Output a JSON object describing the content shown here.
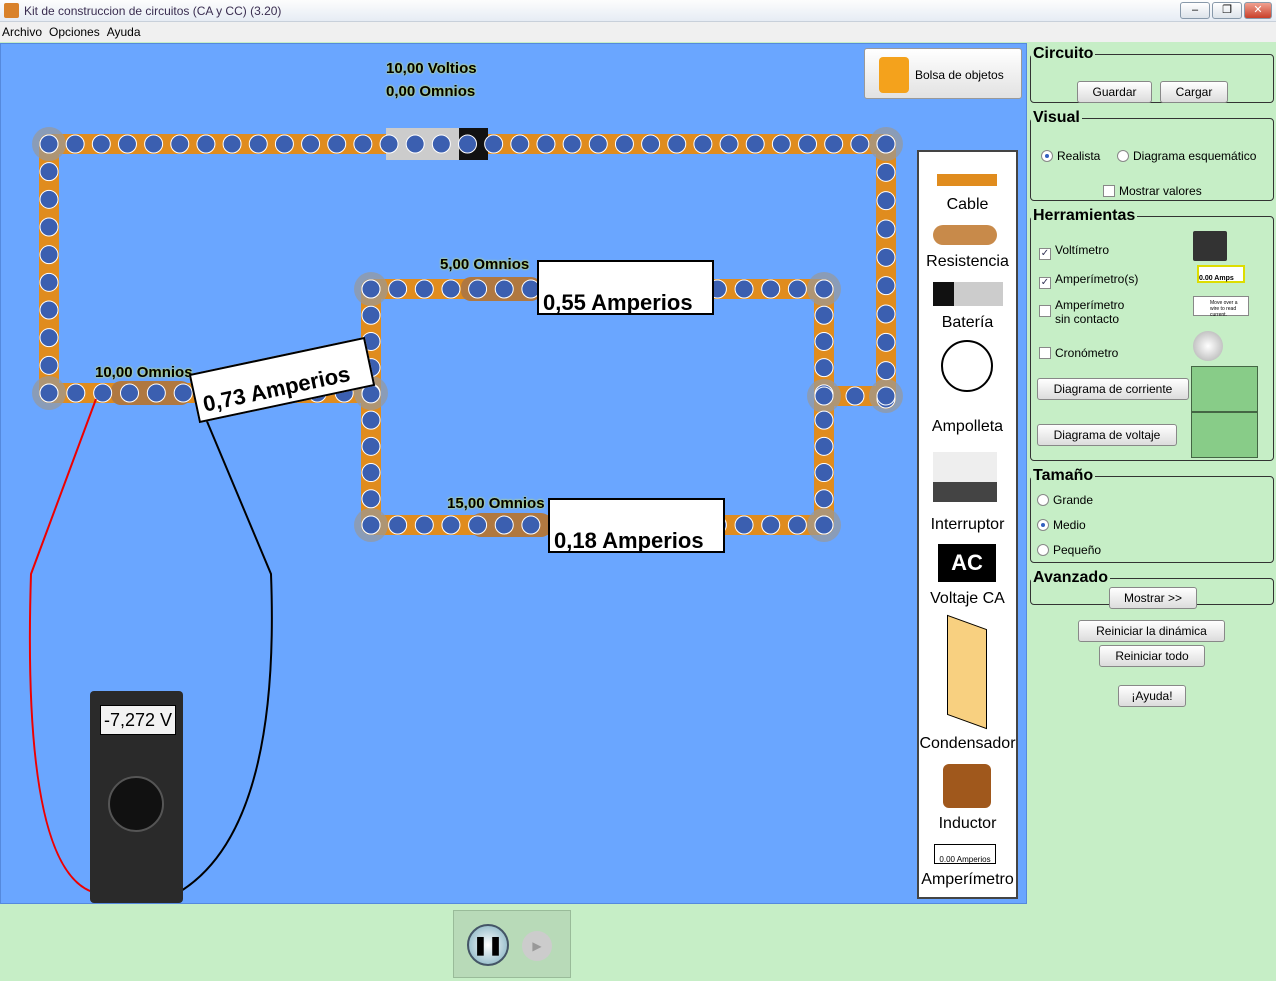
{
  "window": {
    "title": "Kit de construccion de circuitos (CA y CC) (3.20)"
  },
  "menu": [
    "Archivo",
    "Opciones",
    "Ayuda"
  ],
  "canvas": {
    "bag_label": "Bolsa de objetos",
    "battery": {
      "voltage": "10,00 Voltios",
      "resistance": "0,00 Omnios"
    },
    "resistors": [
      "10,00 Omnios",
      "5,00 Omnios",
      "15,00 Omnios"
    ],
    "ammeters": [
      "0,73 Amperios",
      "0,55 Amperios",
      "0,18 Amperios"
    ],
    "voltmeter_reading": "-7,272 V",
    "colors": {
      "background": "#6aa6ff",
      "wire": "#e08c1e",
      "electron": "#3b5fb0"
    }
  },
  "toolbox": [
    "Cable",
    "Resistencia",
    "Batería",
    "Ampolleta",
    "Interruptor",
    "Voltaje CA",
    "Condensador",
    "Inductor",
    "Amperímetro"
  ],
  "toolbox_ac_icon": "AC",
  "toolbox_ammeter_icon": "0.00 Amperios",
  "panel": {
    "circuito": {
      "title": "Circuito",
      "save": "Guardar",
      "load": "Cargar"
    },
    "visual": {
      "title": "Visual",
      "realista": "Realista",
      "esquematico": "Diagrama esquemático",
      "selected": "Realista",
      "mostrar": "Mostrar valores",
      "mostrar_checked": false
    },
    "herramientas": {
      "title": "Herramientas",
      "voltimetro": {
        "label": "Voltímetro",
        "checked": true
      },
      "amperimetros": {
        "label": "Amperímetro(s)",
        "checked": true
      },
      "sin_contacto": {
        "label1": "Amperímetro",
        "label2": "sin contacto",
        "checked": false
      },
      "cronometro": {
        "label": "Cronómetro",
        "checked": false
      },
      "diag_corriente": "Diagrama de corriente",
      "diag_voltaje": "Diagrama de voltaje",
      "amp_icon_text": "0.00 Amps",
      "noncontact_icon_text": "Move over a wire to read current."
    },
    "tamano": {
      "title": "Tamaño",
      "options": [
        "Grande",
        "Medio",
        "Pequeño"
      ],
      "selected": "Medio"
    },
    "avanzado": {
      "title": "Avanzado",
      "mostrar": "Mostrar >>"
    },
    "reiniciar_dinamica": "Reiniciar la dinámica",
    "reiniciar_todo": "Reiniciar todo",
    "ayuda": "¡Ayuda!"
  }
}
